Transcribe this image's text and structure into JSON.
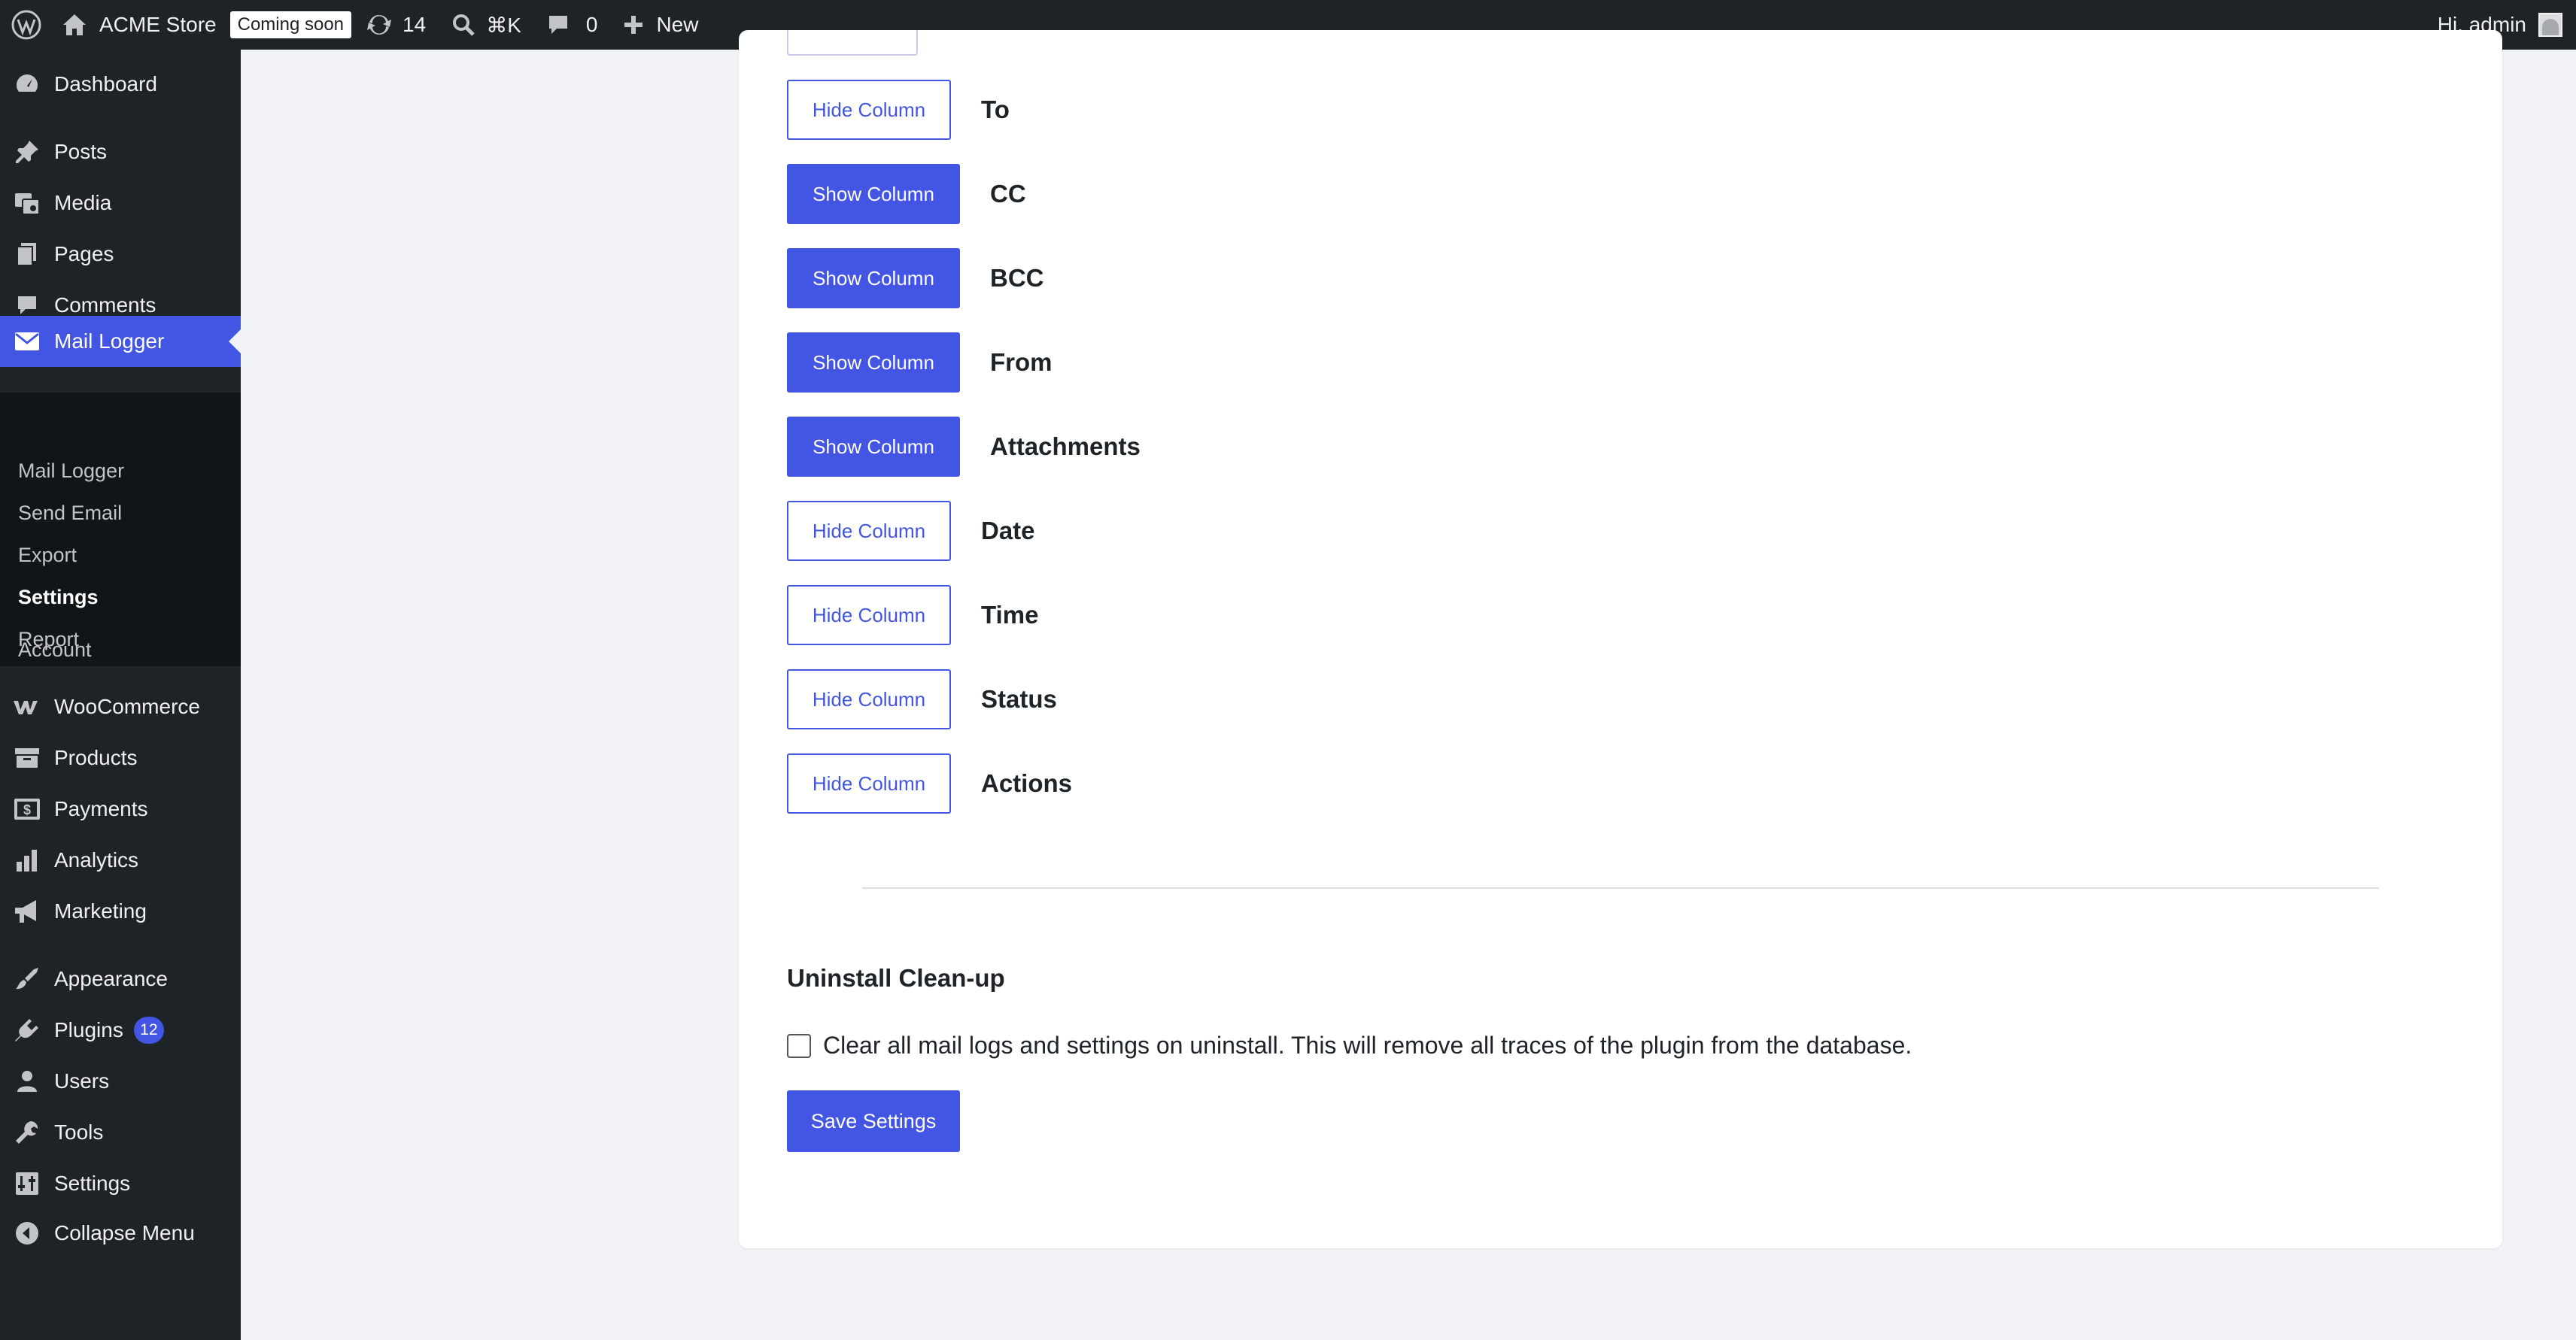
{
  "admin_bar": {
    "site_name": "ACME Store",
    "coming_soon_badge": "Coming soon",
    "updates_count": "14",
    "search_shortcut": "⌘K",
    "comments_count": "0",
    "new_label": "New",
    "greeting": "Hi, admin"
  },
  "sidebar": {
    "menu": {
      "dashboard": "Dashboard",
      "posts": "Posts",
      "media": "Media",
      "pages": "Pages",
      "comments": "Comments",
      "mail_logger": "Mail Logger",
      "woocommerce": "WooCommerce",
      "products": "Products",
      "payments": "Payments",
      "analytics": "Analytics",
      "marketing": "Marketing",
      "appearance": "Appearance",
      "plugins": "Plugins",
      "plugins_count": "12",
      "users": "Users",
      "tools": "Tools",
      "settings": "Settings",
      "collapse": "Collapse Menu"
    },
    "submenu": [
      "Mail Logger",
      "Send Email",
      "Export",
      "Settings",
      "Report",
      "Account"
    ],
    "active_submenu": "Settings"
  },
  "columns": [
    {
      "label": "To",
      "button": "Hide Column",
      "visible": true
    },
    {
      "label": "CC",
      "button": "Show Column",
      "visible": false
    },
    {
      "label": "BCC",
      "button": "Show Column",
      "visible": false
    },
    {
      "label": "From",
      "button": "Show Column",
      "visible": false
    },
    {
      "label": "Attachments",
      "button": "Show Column",
      "visible": false
    },
    {
      "label": "Date",
      "button": "Hide Column",
      "visible": true
    },
    {
      "label": "Time",
      "button": "Hide Column",
      "visible": true
    },
    {
      "label": "Status",
      "button": "Hide Column",
      "visible": true
    },
    {
      "label": "Actions",
      "button": "Hide Column",
      "visible": true
    }
  ],
  "uninstall": {
    "title": "Uninstall Clean-up",
    "checkbox_label": "Clear all mail logs and settings on uninstall. This will remove all traces of the plugin from the database.",
    "checked": false
  },
  "save_button": "Save Settings",
  "colors": {
    "accent": "#4355e3",
    "admin_bar": "#1d2327",
    "sidebar": "#1d2327",
    "submenu": "#101517",
    "background": "#f0f2f6"
  }
}
